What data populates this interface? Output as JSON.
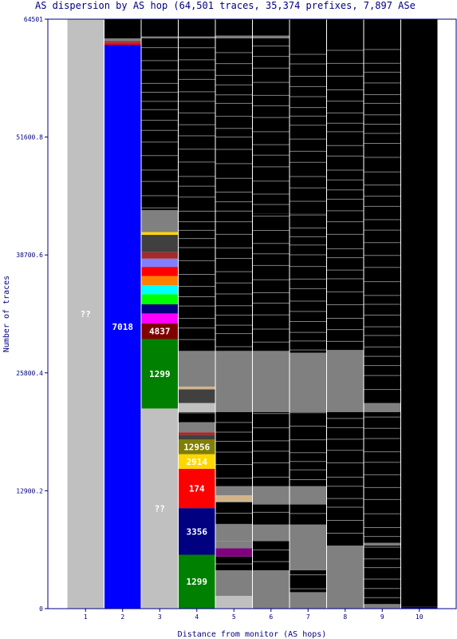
{
  "chart_data": {
    "type": "bar",
    "title": "AS dispersion by AS hop (64,501 traces, 35,374 prefixes, 7,897 ASe",
    "xlabel": "Distance from monitor (AS hops)",
    "ylabel": "Number of traces",
    "ylim": [
      0,
      64501
    ],
    "y_ticks": [
      "0",
      "12900.2",
      "25800.4",
      "38700.6",
      "51600.8",
      "64501"
    ],
    "categories": [
      "1",
      "2",
      "3",
      "4",
      "5",
      "6",
      "7",
      "8",
      "9",
      "10"
    ],
    "colors": {
      "frame": "#000080",
      "unknown": "#c0c0c0",
      "other": "#808080",
      "none": "#000000",
      "blue": "#0000ff",
      "green": "#008000",
      "maroon": "#800000",
      "red": "#ff0000",
      "navy": "#000080",
      "gold": "#ffd700",
      "olive": "#808000",
      "cyan": "#00ffff",
      "lime": "#00ff00",
      "magenta": "#ff00ff",
      "orange": "#ff8000",
      "violet": "#8080ff",
      "purple": "#800080",
      "darkgray": "#404040",
      "brown": "#a52a2a",
      "tan": "#d2b48c"
    },
    "hops": [
      {
        "hop": "1",
        "segments": [
          {
            "from": 0,
            "to": 64501,
            "color": "unknown",
            "label": "??"
          }
        ]
      },
      {
        "hop": "2",
        "segments": [
          {
            "from": 0,
            "to": 61700,
            "color": "blue",
            "label": "7018"
          },
          {
            "from": 61700,
            "to": 61900,
            "color": "red"
          },
          {
            "from": 61900,
            "to": 62100,
            "color": "brown"
          },
          {
            "from": 62100,
            "to": 62400,
            "color": "other"
          },
          {
            "from": 62400,
            "to": 64501,
            "color": "none"
          }
        ]
      },
      {
        "hop": "3",
        "segments": [
          {
            "from": 0,
            "to": 21900,
            "color": "unknown",
            "label": "??"
          },
          {
            "from": 21900,
            "to": 29500,
            "color": "green",
            "label": "1299"
          },
          {
            "from": 29500,
            "to": 31200,
            "color": "maroon",
            "label": "4837"
          },
          {
            "from": 31200,
            "to": 32300,
            "color": "magenta"
          },
          {
            "from": 32300,
            "to": 33300,
            "color": "navy"
          },
          {
            "from": 33300,
            "to": 34400,
            "color": "lime"
          },
          {
            "from": 34400,
            "to": 35400,
            "color": "cyan"
          },
          {
            "from": 35400,
            "to": 36400,
            "color": "orange"
          },
          {
            "from": 36400,
            "to": 37400,
            "color": "red"
          },
          {
            "from": 37400,
            "to": 38300,
            "color": "violet"
          },
          {
            "from": 38300,
            "to": 39000,
            "color": "brown"
          },
          {
            "from": 39000,
            "to": 40900,
            "color": "darkgray"
          },
          {
            "from": 40900,
            "to": 41200,
            "color": "gold"
          },
          {
            "from": 41200,
            "to": 43600,
            "color": "other"
          },
          {
            "from": 43600,
            "to": 62400,
            "color": "none"
          },
          {
            "from": 62400,
            "to": 62600,
            "color": "other"
          },
          {
            "from": 62600,
            "to": 64501,
            "color": "none"
          }
        ]
      },
      {
        "hop": "4",
        "segments": [
          {
            "from": 0,
            "to": 5900,
            "color": "green",
            "label": "1299"
          },
          {
            "from": 5900,
            "to": 11000,
            "color": "navy",
            "label": "3356"
          },
          {
            "from": 11000,
            "to": 15300,
            "color": "red",
            "label": "174"
          },
          {
            "from": 15300,
            "to": 16900,
            "color": "gold",
            "label": "2914"
          },
          {
            "from": 16900,
            "to": 18500,
            "color": "olive",
            "label": "12956"
          },
          {
            "from": 18500,
            "to": 19000,
            "color": "darkgray"
          },
          {
            "from": 19000,
            "to": 19300,
            "color": "brown"
          },
          {
            "from": 19300,
            "to": 20400,
            "color": "other"
          },
          {
            "from": 20400,
            "to": 21500,
            "color": "none"
          },
          {
            "from": 21500,
            "to": 22500,
            "color": "unknown"
          },
          {
            "from": 22500,
            "to": 24000,
            "color": "darkgray"
          },
          {
            "from": 24000,
            "to": 24300,
            "color": "tan"
          },
          {
            "from": 24300,
            "to": 28200,
            "color": "other"
          },
          {
            "from": 28200,
            "to": 43400,
            "color": "none"
          },
          {
            "from": 43400,
            "to": 62400,
            "color": "none"
          },
          {
            "from": 62400,
            "to": 62600,
            "color": "other"
          },
          {
            "from": 62600,
            "to": 64501,
            "color": "none"
          }
        ]
      },
      {
        "hop": "5",
        "segments": [
          {
            "from": 0,
            "to": 1400,
            "color": "unknown"
          },
          {
            "from": 1400,
            "to": 4200,
            "color": "other"
          },
          {
            "from": 4200,
            "to": 5700,
            "color": "none"
          },
          {
            "from": 5700,
            "to": 6600,
            "color": "purple"
          },
          {
            "from": 6600,
            "to": 7400,
            "color": "other"
          },
          {
            "from": 7400,
            "to": 9200,
            "color": "other"
          },
          {
            "from": 9200,
            "to": 11700,
            "color": "none"
          },
          {
            "from": 11700,
            "to": 12400,
            "color": "tan"
          },
          {
            "from": 12400,
            "to": 13400,
            "color": "other"
          },
          {
            "from": 13400,
            "to": 21500,
            "color": "none"
          },
          {
            "from": 21500,
            "to": 28200,
            "color": "other"
          },
          {
            "from": 28200,
            "to": 43400,
            "color": "none"
          },
          {
            "from": 43400,
            "to": 62400,
            "color": "none"
          },
          {
            "from": 62400,
            "to": 62700,
            "color": "other"
          },
          {
            "from": 62700,
            "to": 64501,
            "color": "none"
          }
        ]
      },
      {
        "hop": "6",
        "segments": [
          {
            "from": 0,
            "to": 4200,
            "color": "other"
          },
          {
            "from": 4200,
            "to": 7400,
            "color": "none"
          },
          {
            "from": 7400,
            "to": 9200,
            "color": "other"
          },
          {
            "from": 9200,
            "to": 11400,
            "color": "none"
          },
          {
            "from": 11400,
            "to": 13400,
            "color": "other"
          },
          {
            "from": 13400,
            "to": 21500,
            "color": "none"
          },
          {
            "from": 21500,
            "to": 28200,
            "color": "other"
          },
          {
            "from": 28200,
            "to": 43200,
            "color": "none"
          },
          {
            "from": 43200,
            "to": 62400,
            "color": "none"
          },
          {
            "from": 62400,
            "to": 62700,
            "color": "other"
          },
          {
            "from": 62700,
            "to": 64501,
            "color": "none"
          }
        ]
      },
      {
        "hop": "7",
        "segments": [
          {
            "from": 0,
            "to": 1800,
            "color": "other"
          },
          {
            "from": 1800,
            "to": 4200,
            "color": "none"
          },
          {
            "from": 4200,
            "to": 9200,
            "color": "other"
          },
          {
            "from": 9200,
            "to": 11400,
            "color": "none"
          },
          {
            "from": 11400,
            "to": 13400,
            "color": "other"
          },
          {
            "from": 13400,
            "to": 21500,
            "color": "none"
          },
          {
            "from": 21500,
            "to": 28000,
            "color": "other"
          },
          {
            "from": 28000,
            "to": 43200,
            "color": "none"
          },
          {
            "from": 43200,
            "to": 64501,
            "color": "none"
          }
        ]
      },
      {
        "hop": "8",
        "segments": [
          {
            "from": 0,
            "to": 6900,
            "color": "other"
          },
          {
            "from": 6900,
            "to": 21500,
            "color": "none"
          },
          {
            "from": 21500,
            "to": 28300,
            "color": "other"
          },
          {
            "from": 28300,
            "to": 64501,
            "color": "none"
          }
        ]
      },
      {
        "hop": "9",
        "segments": [
          {
            "from": 0,
            "to": 500,
            "color": "other"
          },
          {
            "from": 500,
            "to": 6900,
            "color": "none"
          },
          {
            "from": 6900,
            "to": 7200,
            "color": "other"
          },
          {
            "from": 7200,
            "to": 21500,
            "color": "none"
          },
          {
            "from": 21500,
            "to": 22500,
            "color": "other"
          },
          {
            "from": 22500,
            "to": 64501,
            "color": "none"
          }
        ]
      },
      {
        "hop": "10",
        "segments": [
          {
            "from": 0,
            "to": 200,
            "color": "navy"
          },
          {
            "from": 200,
            "to": 64501,
            "color": "none"
          }
        ]
      }
    ]
  }
}
